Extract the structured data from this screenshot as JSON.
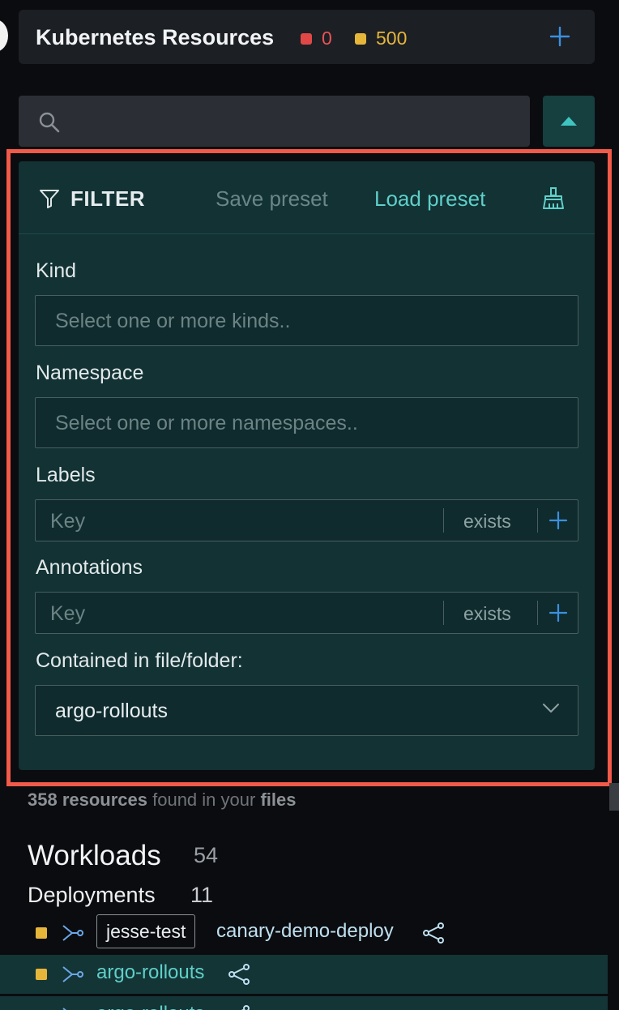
{
  "header": {
    "title": "Kubernetes Resources",
    "error_count": "0",
    "warning_count": "500"
  },
  "colors": {
    "accent": "#5fcfc9",
    "error": "#e04848",
    "warning": "#e6b63a",
    "highlight": "#f25a4a"
  },
  "filter": {
    "title": "FILTER",
    "save_preset": "Save preset",
    "load_preset": "Load preset",
    "kind": {
      "label": "Kind",
      "placeholder": "Select one or more kinds.."
    },
    "namespace": {
      "label": "Namespace",
      "placeholder": "Select one or more namespaces.."
    },
    "labels": {
      "label": "Labels",
      "key_placeholder": "Key",
      "operator": "exists"
    },
    "annotations": {
      "label": "Annotations",
      "key_placeholder": "Key",
      "operator": "exists"
    },
    "folder": {
      "label": "Contained in file/folder:",
      "value": "argo-rollouts"
    }
  },
  "summary": {
    "count": "358 resources",
    "middle": " found in your ",
    "files": "files"
  },
  "workloads": {
    "title": "Workloads",
    "count": "54",
    "deployments": {
      "title": "Deployments",
      "count": "11",
      "items": [
        {
          "namespace": "jesse-test",
          "name": "canary-demo-deploy"
        },
        {
          "namespace": "",
          "name": "argo-rollouts"
        },
        {
          "namespace": "",
          "name": "argo-rollouts"
        }
      ]
    }
  }
}
